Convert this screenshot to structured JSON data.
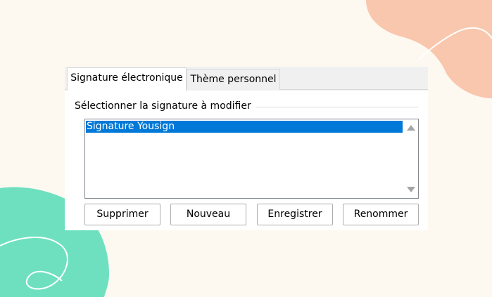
{
  "tabs": [
    {
      "label": "Signature électronique",
      "active": true
    },
    {
      "label": "Thème personnel",
      "active": false
    }
  ],
  "group_label": "Sélectionner la signature à modifier",
  "signatures": [
    {
      "label": "Signature Yousign",
      "selected": true
    }
  ],
  "buttons": {
    "delete": {
      "label": "Supprimer"
    },
    "new": {
      "label": "Nouveau"
    },
    "save": {
      "label": "Enregistrer"
    },
    "rename": {
      "label": "Renommer"
    }
  },
  "colors": {
    "background": "#fdf9f1",
    "peach_blob": "#f9c7ad",
    "mint_blob": "#6ee0c0",
    "selection": "#0078d7"
  },
  "icons": {
    "scroll_up": "scroll-up-arrow",
    "scroll_down": "scroll-down-arrow"
  }
}
